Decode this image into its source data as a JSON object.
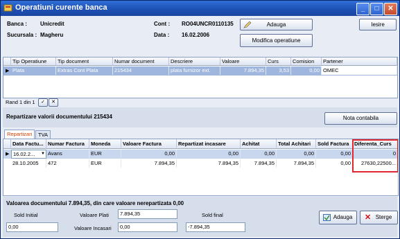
{
  "window": {
    "title": "Operatiuni curente banca"
  },
  "header": {
    "banca_label": "Banca :",
    "banca_value": "Unicredit",
    "sucursala_label": "Sucursala :",
    "sucursala_value": "Magheru",
    "cont_label": "Cont :",
    "cont_value": "RO04UNCR0110135",
    "data_label": "Data :",
    "data_value": "16.02.2006",
    "adauga_label": "Adauga",
    "modifica_label": "Modifica operatiune",
    "iesire_label": "Iesire"
  },
  "operations_grid": {
    "columns": [
      "Tip Operatiune",
      "Tip document",
      "Numar document",
      "Descriere",
      "Valoare",
      "Curs",
      "Comision",
      "Partener"
    ],
    "rows": [
      [
        "Plata",
        "Extras Cont Plata",
        "215434",
        "plata furnizor ext.",
        "7.894,35",
        "3,53",
        "0,00",
        "OMEC"
      ]
    ]
  },
  "navigator": {
    "text": "Rand 1 din 1"
  },
  "repartizare": {
    "title": "Repartizare valorii documentului 215434",
    "nota_label": "Nota contabila",
    "tabs": [
      "Repartizari",
      "TVA"
    ]
  },
  "invoice_grid": {
    "columns": [
      "Data Factu...",
      "Numar Factura",
      "Moneda",
      "Valoare Factura",
      "Repartizat incasare",
      "Achitat",
      "Total Achitari",
      "Sold Factura",
      "Diferenta_Curs"
    ],
    "rows": [
      [
        "16.02.2...",
        "Avans",
        "EUR",
        "0,00",
        "0,00",
        "0,00",
        "0,00",
        "0,00",
        "0"
      ],
      [
        "28.10.2005",
        "472",
        "EUR",
        "7.894,35",
        "7.894,35",
        "7.894,35",
        "7.894,35",
        "0,00",
        "27630,22500..."
      ]
    ],
    "highlight_color": "#e0262e"
  },
  "footer": {
    "summary": "Valoarea documentului 7.894,35, din care valoare nerepartizata 0,00",
    "sold_initial_label": "Sold Initial",
    "sold_initial_value": "0,00",
    "valoare_plati_label": "Valoare Plati",
    "valoare_plati_value": "7.894,35",
    "valoare_incasari_label": "Valoare Incasari",
    "valoare_incasari_value": "0,00",
    "sold_final_label": "Sold final",
    "sold_final_value": "-7.894,35",
    "adauga_label": "Adauga",
    "sterge_label": "Sterge"
  }
}
